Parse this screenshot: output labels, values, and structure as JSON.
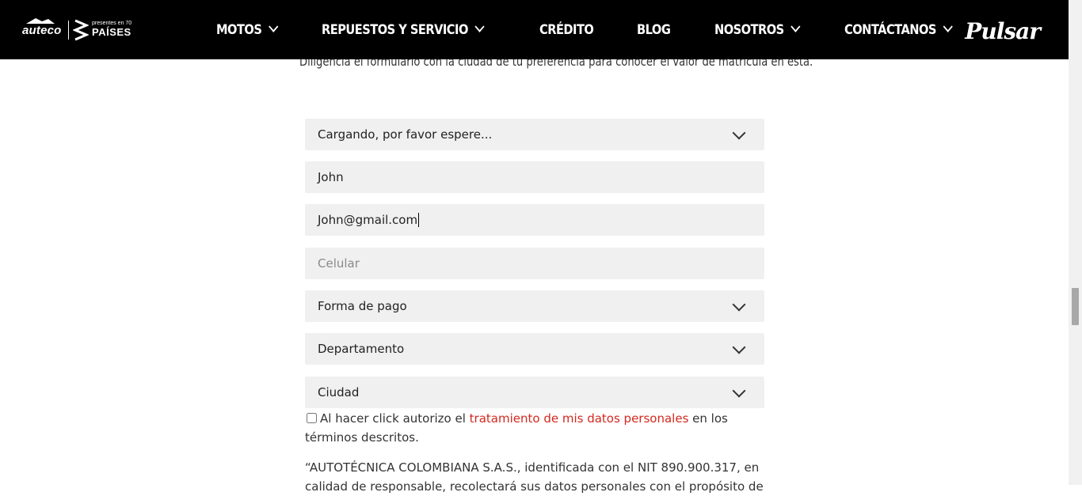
{
  "header": {
    "brand_auteco": "auteco",
    "brand_70_small": "presentes en 70",
    "brand_70_big": "PAÍSES",
    "nav": [
      {
        "label": "MOTOS"
      },
      {
        "label": "REPUESTOS Y SERVICIO"
      },
      {
        "label": "CRÉDITO"
      },
      {
        "label": "BLOG"
      },
      {
        "label": "NOSOTROS"
      },
      {
        "label": "CONTÁCTANOS"
      }
    ],
    "pulsar": "Pulsar"
  },
  "intro_text": "Diligencia el formulario con la ciudad de tu preferencia para conocer el valor de matrícula en esta.",
  "form": {
    "loading_select": "Cargando, por favor espere...",
    "name_value": "John",
    "email_value": "John@gmail.com",
    "phone_placeholder": "Celular",
    "payment_select": "Forma de pago",
    "department_select": "Departamento",
    "city_select": "Ciudad",
    "consent_before": "Al hacer click autorizo el ",
    "consent_link": "tratamiento de mis datos personales",
    "consent_after": " en los términos descritos.",
    "legal_text": "“AUTOTÉCNICA COLOMBIANA S.A.S., identificada con el NIT 890.900.317, en calidad de responsable, recolectará sus datos personales con el propósito de"
  },
  "colors": {
    "header_bg": "#000000",
    "field_bg": "#f0f0f0",
    "link": "#d2281e"
  }
}
